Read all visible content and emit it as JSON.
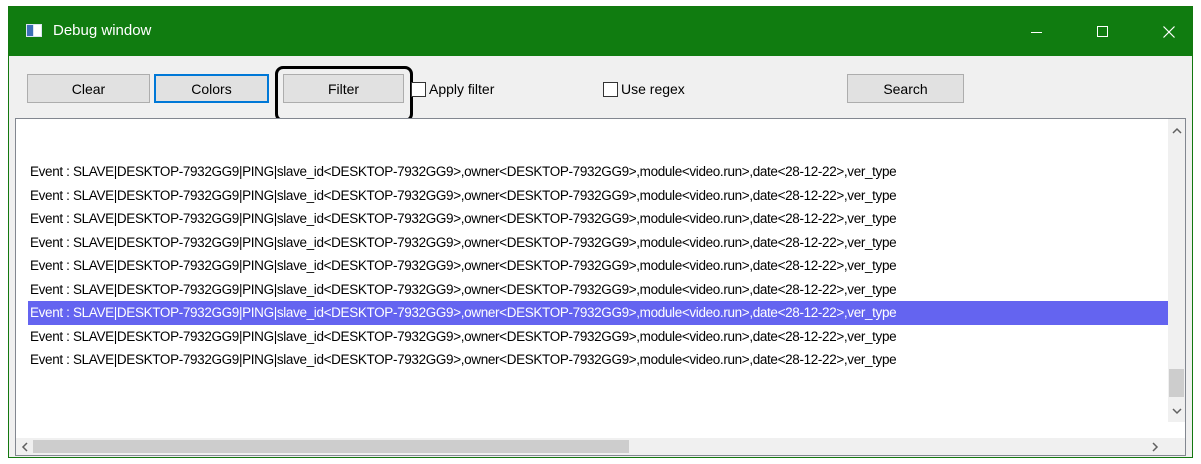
{
  "window": {
    "title": "Debug window",
    "colors": {
      "titlebar": "#107c10",
      "selection": "#6464f0",
      "focus_border": "#0078d7"
    },
    "controls": {
      "minimize_icon": "minimize-icon",
      "maximize_icon": "maximize-icon",
      "close_icon": "close-icon"
    }
  },
  "toolbar": {
    "clear_label": "Clear",
    "colors_label": "Colors",
    "filter_label": "Filter",
    "apply_filter_label": "Apply filter",
    "apply_filter_checked": false,
    "use_regex_label": "Use regex",
    "use_regex_checked": false,
    "search_label": "Search"
  },
  "log": {
    "lines": [
      {
        "text": "Event : SLAVE|DESKTOP-7932GG9|PING|slave_id<DESKTOP-7932GG9>,owner<DESKTOP-7932GG9>,module<video.run>,date<28-12-22>,ver_type",
        "selected": false
      },
      {
        "text": "Event : SLAVE|DESKTOP-7932GG9|PING|slave_id<DESKTOP-7932GG9>,owner<DESKTOP-7932GG9>,module<video.run>,date<28-12-22>,ver_type",
        "selected": false
      },
      {
        "text": "Event : SLAVE|DESKTOP-7932GG9|PING|slave_id<DESKTOP-7932GG9>,owner<DESKTOP-7932GG9>,module<video.run>,date<28-12-22>,ver_type",
        "selected": false
      },
      {
        "text": "Event : SLAVE|DESKTOP-7932GG9|PING|slave_id<DESKTOP-7932GG9>,owner<DESKTOP-7932GG9>,module<video.run>,date<28-12-22>,ver_type",
        "selected": false
      },
      {
        "text": "Event : SLAVE|DESKTOP-7932GG9|PING|slave_id<DESKTOP-7932GG9>,owner<DESKTOP-7932GG9>,module<video.run>,date<28-12-22>,ver_type",
        "selected": false
      },
      {
        "text": "Event : SLAVE|DESKTOP-7932GG9|PING|slave_id<DESKTOP-7932GG9>,owner<DESKTOP-7932GG9>,module<video.run>,date<28-12-22>,ver_type",
        "selected": false
      },
      {
        "text": "Event : SLAVE|DESKTOP-7932GG9|PING|slave_id<DESKTOP-7932GG9>,owner<DESKTOP-7932GG9>,module<video.run>,date<28-12-22>,ver_type",
        "selected": true
      },
      {
        "text": "Event : SLAVE|DESKTOP-7932GG9|PING|slave_id<DESKTOP-7932GG9>,owner<DESKTOP-7932GG9>,module<video.run>,date<28-12-22>,ver_type",
        "selected": false
      },
      {
        "text": "Event : SLAVE|DESKTOP-7932GG9|PING|slave_id<DESKTOP-7932GG9>,owner<DESKTOP-7932GG9>,module<video.run>,date<28-12-22>,ver_type",
        "selected": false
      }
    ]
  },
  "scrollbars": {
    "up_icon": "chevron-up-icon",
    "down_icon": "chevron-down-icon",
    "left_icon": "chevron-left-icon",
    "right_icon": "chevron-right-icon"
  }
}
